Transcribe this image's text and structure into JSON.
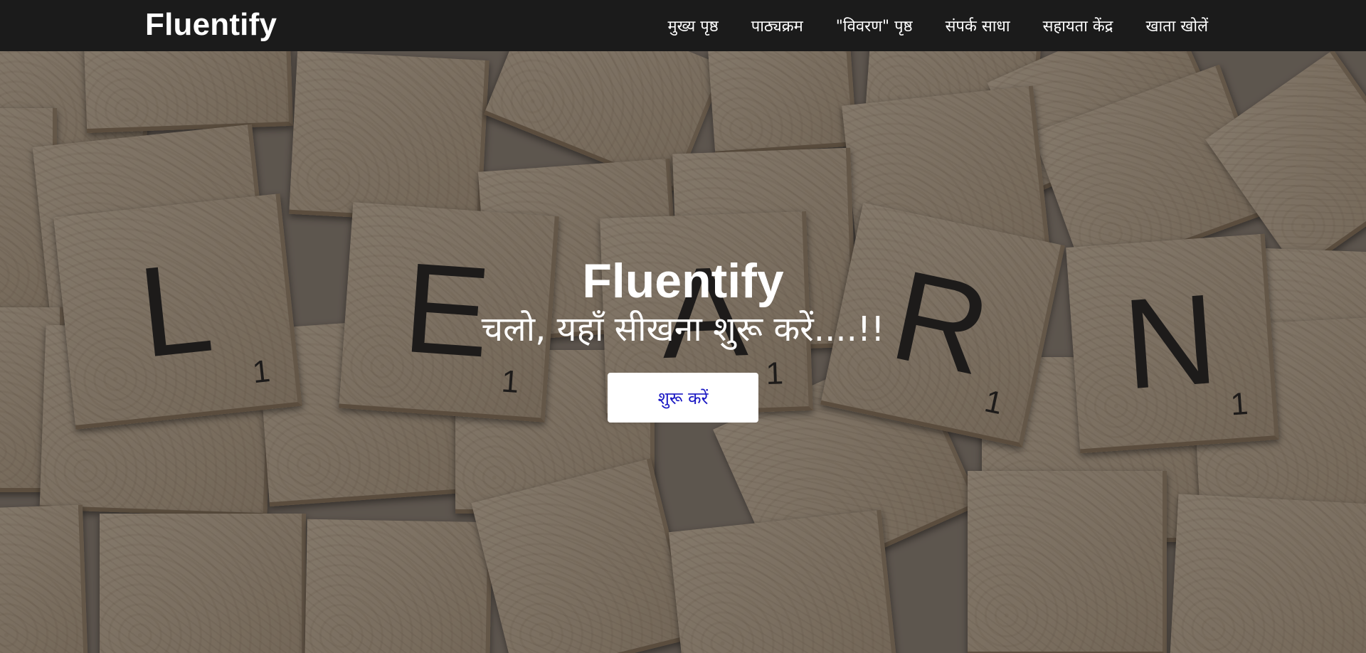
{
  "navbar": {
    "brand": "Fluentify",
    "links": [
      {
        "label": "मुख्य पृष्ठ"
      },
      {
        "label": "पाठ्यक्रम"
      },
      {
        "label": "\"विवरण\" पृष्ठ"
      },
      {
        "label": "संपर्क साधा"
      },
      {
        "label": "सहायता केंद्र"
      },
      {
        "label": "खाता खोलें"
      }
    ]
  },
  "hero": {
    "title": "Fluentify",
    "subtitle": "चलो, यहाँ सीखना शुरू करें....!!",
    "button_label": "शुरू करें",
    "background_tiles": [
      {
        "letter": "L",
        "score": "1"
      },
      {
        "letter": "E",
        "score": "1"
      },
      {
        "letter": "A",
        "score": "1"
      },
      {
        "letter": "R",
        "score": "1"
      },
      {
        "letter": "N",
        "score": "1"
      }
    ]
  },
  "colors": {
    "navbar_bg": "#1b1b1b",
    "nav_text": "#ffffff",
    "button_bg": "#ffffff",
    "button_text": "#1a18c4"
  }
}
